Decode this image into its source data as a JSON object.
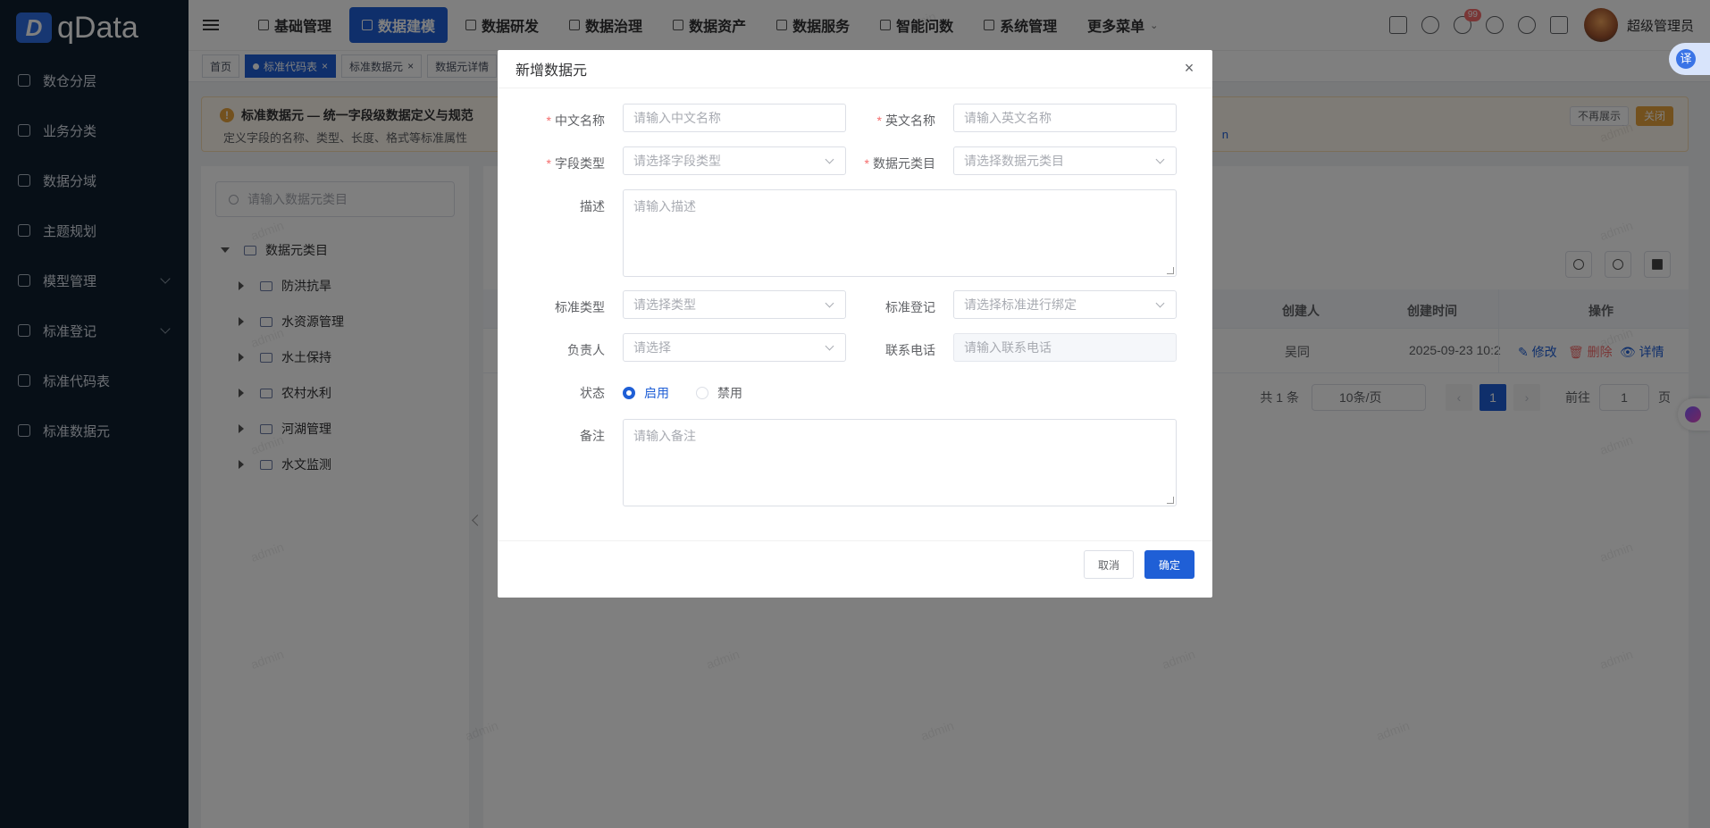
{
  "brand": {
    "logo_letter": "D",
    "name": "qData"
  },
  "sidebar": {
    "items": [
      {
        "label": "数仓分层",
        "icon": "layers-icon",
        "has_children": false
      },
      {
        "label": "业务分类",
        "icon": "list-icon",
        "has_children": false
      },
      {
        "label": "数据分域",
        "icon": "domain-icon",
        "has_children": false
      },
      {
        "label": "主题规划",
        "icon": "theme-icon",
        "has_children": false
      },
      {
        "label": "模型管理",
        "icon": "cube-icon",
        "has_children": true
      },
      {
        "label": "标准登记",
        "icon": "register-icon",
        "has_children": true
      },
      {
        "label": "标准代码表",
        "icon": "table-icon",
        "has_children": false
      },
      {
        "label": "标准数据元",
        "icon": "element-icon",
        "has_children": false
      }
    ]
  },
  "topnav": {
    "items": [
      {
        "label": "基础管理",
        "active": false
      },
      {
        "label": "数据建模",
        "active": true
      },
      {
        "label": "数据研发",
        "active": false
      },
      {
        "label": "数据治理",
        "active": false
      },
      {
        "label": "数据资产",
        "active": false
      },
      {
        "label": "数据服务",
        "active": false
      },
      {
        "label": "智能问数",
        "active": false
      },
      {
        "label": "系统管理",
        "active": false
      }
    ],
    "more": "更多菜单",
    "notification_count": "99",
    "username": "超级管理员",
    "translate_label": "译"
  },
  "tags": [
    {
      "label": "首页",
      "active": false,
      "closable": false
    },
    {
      "label": "标准代码表",
      "active": true,
      "closable": true
    },
    {
      "label": "标准数据元",
      "active": false,
      "closable": true
    },
    {
      "label": "数据元详情",
      "active": false,
      "closable": false
    }
  ],
  "alert": {
    "title": "标准数据元 — 统一字段级数据定义与规范",
    "desc": "定义字段的名称、类型、长度、格式等标准属性",
    "dismiss_label": "不再展示",
    "close_label": "关闭",
    "link_fragment": "n"
  },
  "left_panel": {
    "search_placeholder": "请输入数据元类目",
    "root": "数据元类目",
    "nodes": [
      "防洪抗旱",
      "水资源管理",
      "水土保持",
      "农村水利",
      "河湖管理",
      "水文监测"
    ]
  },
  "table": {
    "headers": {
      "creator": "创建人",
      "created_at": "创建时间",
      "ops": "操作"
    },
    "rows": [
      {
        "creator": "吴同",
        "created_at": "2025-09-23 10:2",
        "edit": "修改",
        "delete": "删除",
        "detail": "详情"
      }
    ]
  },
  "pagination": {
    "total": "共 1 条",
    "page_size": "10条/页",
    "current": "1",
    "goto_label": "前往",
    "goto_value": "1",
    "page_suffix": "页"
  },
  "watermark_text": "admin",
  "modal": {
    "title": "新增数据元",
    "close_symbol": "×",
    "fields": {
      "cn_name": {
        "label": "中文名称",
        "placeholder": "请输入中文名称",
        "required": true
      },
      "en_name": {
        "label": "英文名称",
        "placeholder": "请输入英文名称",
        "required": true
      },
      "field_type": {
        "label": "字段类型",
        "placeholder": "请选择字段类型",
        "required": true
      },
      "category": {
        "label": "数据元类目",
        "placeholder": "请选择数据元类目",
        "required": true
      },
      "description": {
        "label": "描述",
        "placeholder": "请输入描述"
      },
      "std_type": {
        "label": "标准类型",
        "placeholder": "请选择类型"
      },
      "std_register": {
        "label": "标准登记",
        "placeholder": "请选择标准进行绑定"
      },
      "owner": {
        "label": "负责人",
        "placeholder": "请选择"
      },
      "phone": {
        "label": "联系电话",
        "placeholder": "请输入联系电话"
      },
      "status": {
        "label": "状态",
        "options": [
          "启用",
          "禁用"
        ],
        "selected": "启用"
      },
      "remark": {
        "label": "备注",
        "placeholder": "请输入备注"
      }
    },
    "cancel_label": "取消",
    "confirm_label": "确定"
  }
}
